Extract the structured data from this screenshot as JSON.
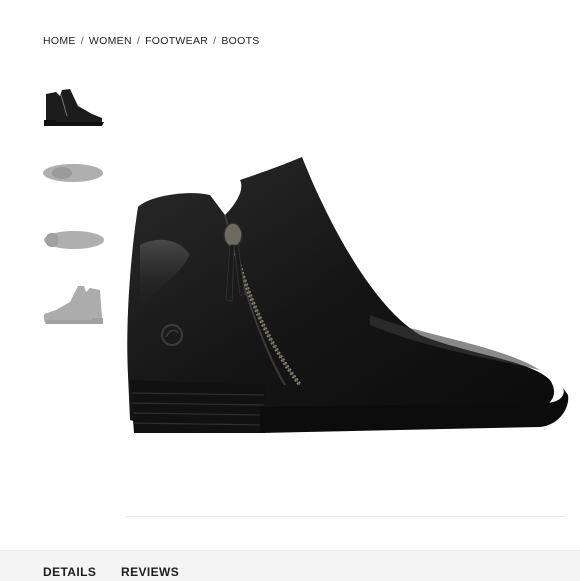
{
  "breadcrumb": {
    "items": [
      "HOME",
      "WOMEN",
      "FOOTWEAR",
      "BOOTS"
    ],
    "separator": "/"
  },
  "gallery": {
    "thumbnails": [
      {
        "view": "side",
        "active": true
      },
      {
        "view": "top",
        "active": false
      },
      {
        "view": "sole",
        "active": false
      },
      {
        "view": "back",
        "active": false
      }
    ],
    "main_image": "black leather ankle boot with side zipper"
  },
  "tabs": {
    "details_label": "DETAILS",
    "reviews_label": "REVIEWS"
  },
  "colors": {
    "boot": "#1c1c1c",
    "thumb_gray": "#8a8a8a",
    "tab_bg": "#f4f4f4"
  }
}
